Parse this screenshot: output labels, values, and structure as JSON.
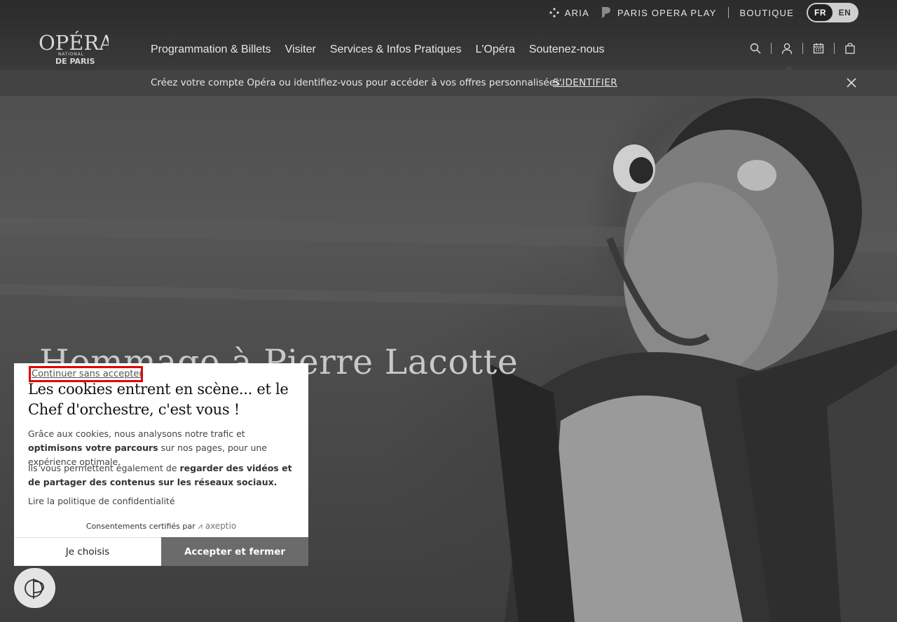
{
  "topbar": {
    "aria": "ARIA",
    "play": "PARIS OPERA PLAY",
    "boutique": "BOUTIQUE",
    "lang_fr": "FR",
    "lang_en": "EN"
  },
  "logo": {
    "line1": "OPÉRA",
    "line2": "NATIONAL",
    "line3": "DE PARIS"
  },
  "nav": {
    "items": [
      "Programmation & Billets",
      "Visiter",
      "Services & Infos Pratiques",
      "L'Opéra",
      "Soutenez-nous"
    ]
  },
  "banner": {
    "text": "Créez votre compte Opéra ou identifiez-vous pour accéder à vos offres personnalisées.",
    "link": "S'IDENTIFIER"
  },
  "hero": {
    "title": "Hommage à Pierre Lacotte"
  },
  "cookie": {
    "skip": "Continuer sans accepter",
    "title": "Les cookies entrent en scène... et le Chef d'orchestre, c'est vous !",
    "p1_a": "Grâce aux cookies, nous analysons notre trafic et ",
    "p1_b": "optimisons votre parcours",
    "p1_c": " sur nos pages, pour une expérience optimale.",
    "p2_a": "Ils vous permettent également de ",
    "p2_b": "regarder des vidéos et de partager des contenus sur les réseaux sociaux.",
    "privacy": "Lire la politique de confidentialité",
    "certified": "Consentements certifiés par",
    "brand": "axeptio",
    "choose": "Je choisis",
    "accept": "Accepter et fermer"
  },
  "colors": {
    "header_bg": "#2b2b2b",
    "banner_bg": "#434343",
    "accept_bg": "#6b6b6b",
    "focus_outline": "#e00000"
  }
}
